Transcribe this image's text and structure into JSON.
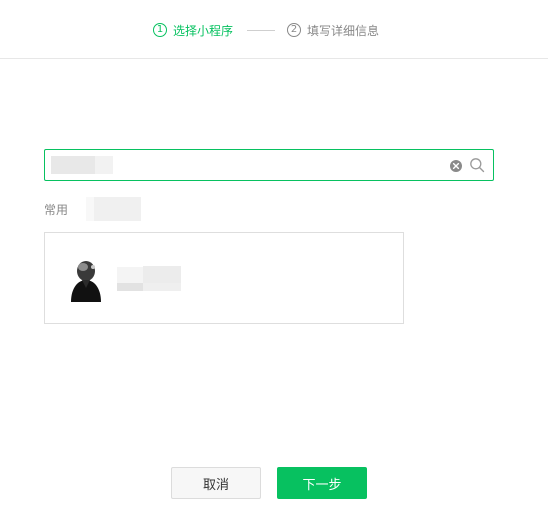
{
  "steps": [
    {
      "num": "1",
      "label": "选择小程序"
    },
    {
      "num": "2",
      "label": "填写详细信息"
    }
  ],
  "search": {
    "value": "",
    "placeholder": ""
  },
  "common": {
    "label": "常用"
  },
  "buttons": {
    "cancel": "取消",
    "next": "下一步"
  },
  "colors": {
    "accent": "#07c160",
    "inactive_step": "#888888",
    "border": "#dedede"
  },
  "icons": {
    "clear": "clear-circle-icon",
    "search": "search-icon"
  }
}
